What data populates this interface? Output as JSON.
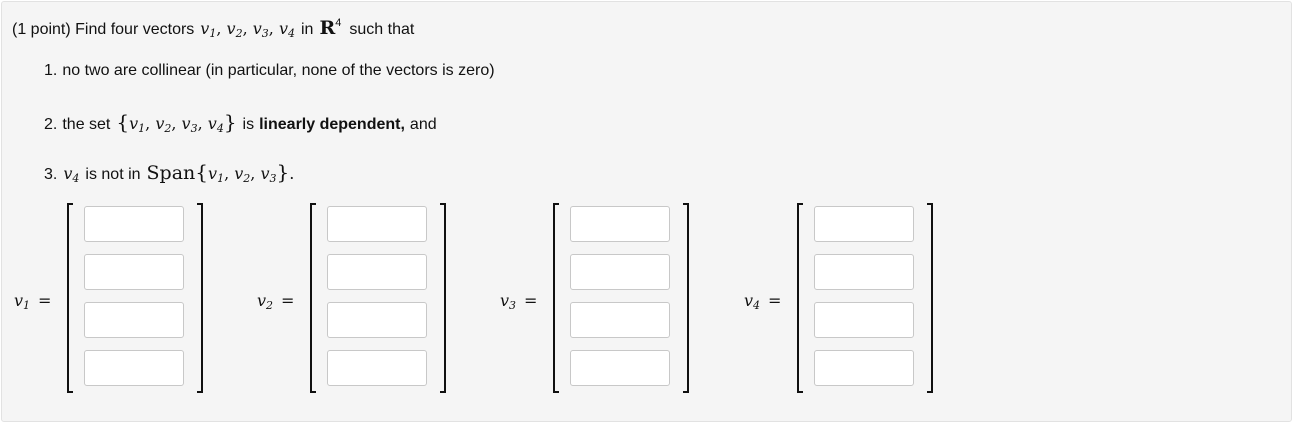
{
  "question": {
    "prefix": "(1 point) Find four vectors",
    "vars": [
      "v",
      "v",
      "v",
      "v"
    ],
    "in_word": "in",
    "space_letter": "R",
    "space_exp": "4",
    "suffix": "such that",
    "items": [
      {
        "number": "1.",
        "text": "no two are collinear (in particular, none of the vectors is zero)"
      },
      {
        "number": "2.",
        "pre": "the set",
        "bold": "linearly dependent,",
        "is_word": "is",
        "post": "and"
      },
      {
        "number": "3.",
        "is_not": "is not in",
        "span_word": "Span"
      }
    ]
  },
  "vectors": [
    {
      "symbol": "v",
      "index": "1",
      "eq": "=",
      "entries": [
        "",
        "",
        "",
        ""
      ]
    },
    {
      "symbol": "v",
      "index": "2",
      "eq": "=",
      "entries": [
        "",
        "",
        "",
        ""
      ]
    },
    {
      "symbol": "v",
      "index": "3",
      "eq": "=",
      "entries": [
        "",
        "",
        "",
        ""
      ]
    },
    {
      "symbol": "v",
      "index": "4",
      "eq": "=",
      "entries": [
        "",
        "",
        "",
        ""
      ]
    }
  ]
}
